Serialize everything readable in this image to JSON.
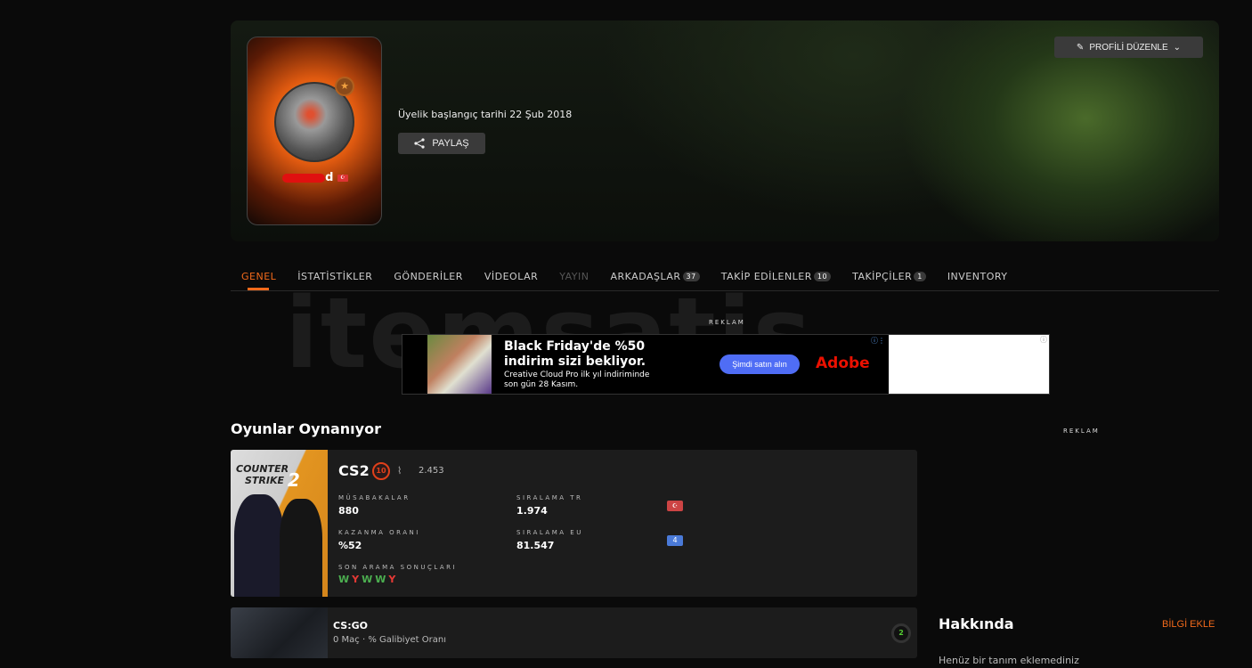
{
  "profile": {
    "username_visible": "d",
    "member_since": "Üyelik başlangıç tarihi 22 Şub 2018",
    "share_label": "PAYLAŞ",
    "edit_label": "PROFİLİ DÜZENLE"
  },
  "tabs": [
    {
      "label": "GENEL"
    },
    {
      "label": "İSTATİSTİKLER"
    },
    {
      "label": "GÖNDERİLER"
    },
    {
      "label": "VİDEOLAR"
    },
    {
      "label": "YAYIN"
    },
    {
      "label": "ARKADAŞLAR",
      "count": "37"
    },
    {
      "label": "TAKİP EDİLENLER",
      "count": "10"
    },
    {
      "label": "TAKİPÇİLER",
      "count": "1"
    },
    {
      "label": "INVENTORY"
    }
  ],
  "watermark": "itemsatis",
  "ad": {
    "label": "REKLAM",
    "headline1": "Black Friday'de %50",
    "headline2": "indirim sizi bekliyor.",
    "sub1": "Creative Cloud Pro ilk yıl indiriminde",
    "sub2": "son gün 28 Kasım.",
    "cta": "Şimdi satın alın",
    "brand": "Adobe"
  },
  "games": {
    "title": "Oyunlar Oynanıyor",
    "side_ad_label": "REKLAM",
    "cs2": {
      "logo1": "COUNTER",
      "logo2": "STRIKE",
      "logo3": "2",
      "name": "CS2",
      "level": "10",
      "elo": "2.453",
      "matches_label": "MÜSABAKALAR",
      "matches": "880",
      "winrate_label": "KAZANMA ORANI",
      "winrate": "%52",
      "rank_tr_label": "SIRALAMA TR",
      "rank_tr": "1.974",
      "rank_eu_label": "SIRALAMA EU",
      "rank_eu": "81.547",
      "recent_label": "SON ARAMA SONUÇLARI",
      "recent": [
        "W",
        "Y",
        "W",
        "W",
        "Y"
      ],
      "win_color": "#4caf50",
      "loss_color": "#e53935"
    },
    "csgo": {
      "name": "CS:GO",
      "summary": "0 Maç · % Galibiyet Oranı",
      "level": "2"
    }
  },
  "about": {
    "title": "Hakkında",
    "add_label": "BİLGİ EKLE",
    "empty": "Henüz bir tanım eklemediniz"
  }
}
